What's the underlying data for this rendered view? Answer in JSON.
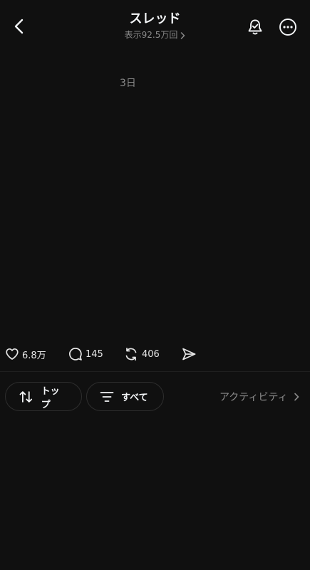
{
  "header": {
    "title": "スレッド",
    "views": "表示92.5万回",
    "icons": [
      "back-arrow-icon",
      "bell-check-icon",
      "more-icon",
      "chevron-right-icon"
    ]
  },
  "post": {
    "timestamp": "3日"
  },
  "actions": {
    "likes": "6.8万",
    "replies": "145",
    "reposts": "406",
    "icons": [
      "heart-icon",
      "comment-icon",
      "repost-icon",
      "send-icon"
    ]
  },
  "filters": {
    "sort_label": "トップ",
    "filter_label": "すべて",
    "activity_label": "アクティビティ"
  },
  "colors": {
    "background": "#101010",
    "text": "#f3f5f7",
    "muted": "#8a8a8a",
    "border": "#2e2e2e"
  }
}
